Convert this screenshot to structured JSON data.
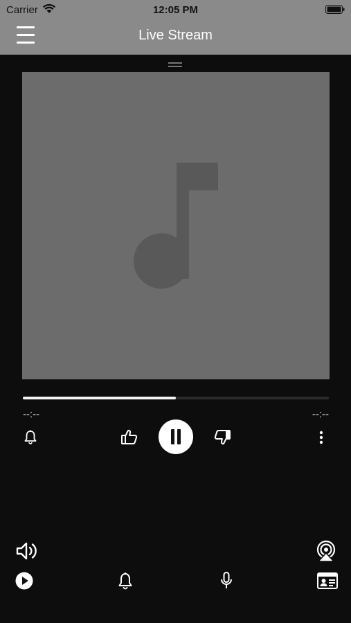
{
  "status_bar": {
    "carrier": "Carrier",
    "time": "12:05 PM"
  },
  "header": {
    "title": "Live Stream"
  },
  "player": {
    "elapsed": "--:--",
    "remaining": "--:--",
    "progress_fraction": 0.5
  },
  "controls": [
    "alarm-bell-icon",
    "thumbs-up-icon",
    "pause-button",
    "thumbs-down-icon",
    "more-options-icon"
  ],
  "bottom_bar": [
    "volume-icon",
    "airplay-icon",
    "play-icon",
    "bell-icon",
    "microphone-icon",
    "contact-card-icon"
  ],
  "colors": {
    "background": "#0d0d0d",
    "header": "#8a8a8a",
    "artwork": "#6c6c6c",
    "note": "#595959"
  }
}
